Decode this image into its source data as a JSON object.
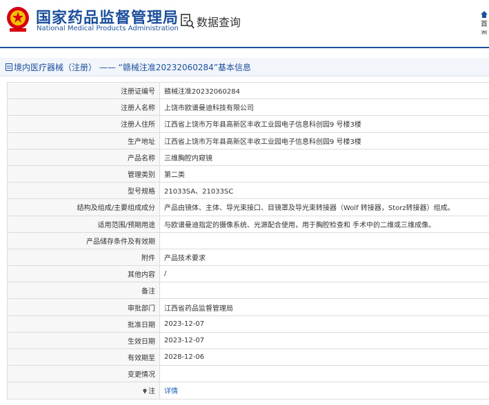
{
  "header": {
    "site_name_cn": "国家药品监督管理局",
    "site_name_en": "National Medical Products Administration",
    "search_label": "数据查询",
    "home_label": "首页"
  },
  "title_bar": {
    "text": "境内医疗器械（注册） —— “赣械注准20232060284”基本信息"
  },
  "rows": [
    {
      "label": "注册证编号",
      "value": "赣械注准20232060284"
    },
    {
      "label": "注册人名称",
      "value": "上饶市欧谱曼迪科技有限公司"
    },
    {
      "label": "注册人住所",
      "value": "江西省上饶市万年县高新区丰收工业园电子信息科创园9 号楼3楼"
    },
    {
      "label": "生产地址",
      "value": "江西省上饶市万年县高新区丰收工业园电子信息科创园9 号楼3楼"
    },
    {
      "label": "产品名称",
      "value": "三维胸腔内窥镜"
    },
    {
      "label": "管理类别",
      "value": "第二类"
    },
    {
      "label": "型号规格",
      "value": "21033SA、21033SC"
    },
    {
      "label": "结构及组成/主要组成成分",
      "value": "产品由镜体、主体、导光束接口、目镜罩及导光束转接器（Wolf 转接器，Storz转接器）组成。"
    },
    {
      "label": "适用范围/预期用途",
      "value": "与欧谱曼迪指定的摄像系统、光源配合使用，用于胸腔检查和 手术中的二维或三维成像。"
    },
    {
      "label": "产品储存条件及有效期",
      "value": ""
    },
    {
      "label": "附件",
      "value": "产品技术要求"
    },
    {
      "label": "其他内容",
      "value": "/"
    },
    {
      "label": "备注",
      "value": ""
    },
    {
      "label": "审批部门",
      "value": "江西省药品监督管理局"
    },
    {
      "label": "批准日期",
      "value": "2023-12-07"
    },
    {
      "label": "生效日期",
      "value": "2023-12-07"
    },
    {
      "label": "有效期至",
      "value": "2028-12-06"
    },
    {
      "label": "变更情况",
      "value": ""
    }
  ],
  "note_row": {
    "label": "注",
    "value": "详情"
  },
  "colors": {
    "brand_blue": "#1b4f9c",
    "emblem_red": "#d7000f",
    "link_blue": "#1e5fb8"
  }
}
